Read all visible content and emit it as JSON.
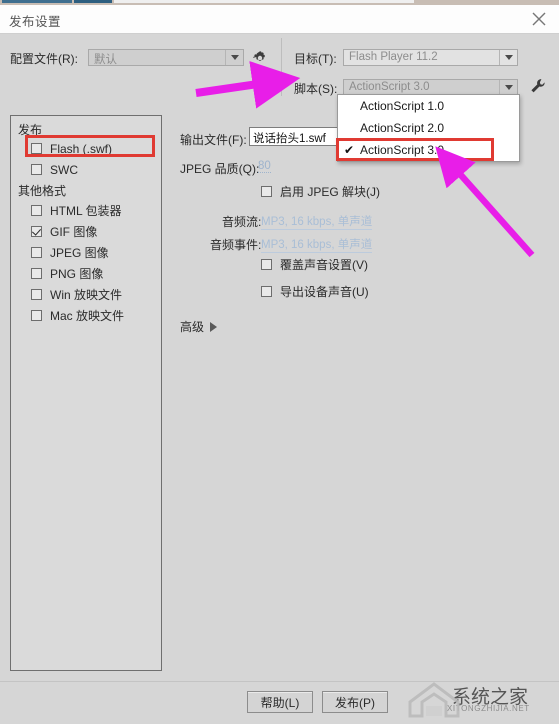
{
  "window": {
    "title": "发布设置",
    "close_icon": "close-icon"
  },
  "toolbar": {
    "profile_label": "配置文件(R):",
    "profile_value": "默认",
    "gear_icon": "gear-icon",
    "target_label": "目标(T):",
    "target_value": "Flash Player 11.2",
    "script_label": "脚本(S):",
    "script_value": "ActionScript 3.0",
    "wrench_icon": "wrench-icon"
  },
  "script_dropdown": {
    "open": true,
    "items": [
      {
        "label": "ActionScript 1.0",
        "checked": false
      },
      {
        "label": "ActionScript 2.0",
        "checked": false
      },
      {
        "label": "ActionScript 3.0",
        "checked": true
      }
    ],
    "check_glyph": "✔",
    "highlight_color": "#e03a32"
  },
  "sidebar": {
    "group_publish": "发布",
    "group_other": "其他格式",
    "publish_items": [
      {
        "label": "Flash (.swf)",
        "checked": false,
        "highlighted": true
      },
      {
        "label": "SWC",
        "checked": false,
        "highlighted": false
      }
    ],
    "other_items": [
      {
        "label": "HTML 包装器",
        "checked": false
      },
      {
        "label": "GIF 图像",
        "checked": true
      },
      {
        "label": "JPEG 图像",
        "checked": false
      },
      {
        "label": "PNG 图像",
        "checked": false
      },
      {
        "label": "Win 放映文件",
        "checked": false
      },
      {
        "label": "Mac 放映文件",
        "checked": false
      }
    ]
  },
  "main": {
    "output_label": "输出文件(F):",
    "output_value": "说话抬头1.swf",
    "jpeg_quality_label": "JPEG 品质(Q):",
    "jpeg_quality_value": "80",
    "enable_jpeg_label": "启用 JPEG 解块(J)",
    "enable_jpeg_checked": false,
    "audio_stream_label": "音频流:",
    "audio_stream_value": "MP3, 16 kbps, 单声道",
    "audio_event_label": "音频事件:",
    "audio_event_value": "MP3, 16 kbps, 单声道",
    "override_sound_label": "覆盖声音设置(V)",
    "override_sound_checked": false,
    "export_device_label": "导出设备声音(U)",
    "export_device_checked": false,
    "advanced_label": "高级",
    "advanced_icon": "chevron-right-icon"
  },
  "footer": {
    "help_label": "帮助(L)",
    "publish_label": "发布(P)"
  },
  "watermark": {
    "text": "系统之家",
    "subtext": "XITONGZHIJIA.NET",
    "logo_icon": "house-logo-icon"
  },
  "annotations": {
    "arrow_color": "#e81ee8",
    "arrow_1": "arrow-pointing-to-script-dropdown",
    "arrow_2": "arrow-pointing-to-actionscript3-item"
  }
}
